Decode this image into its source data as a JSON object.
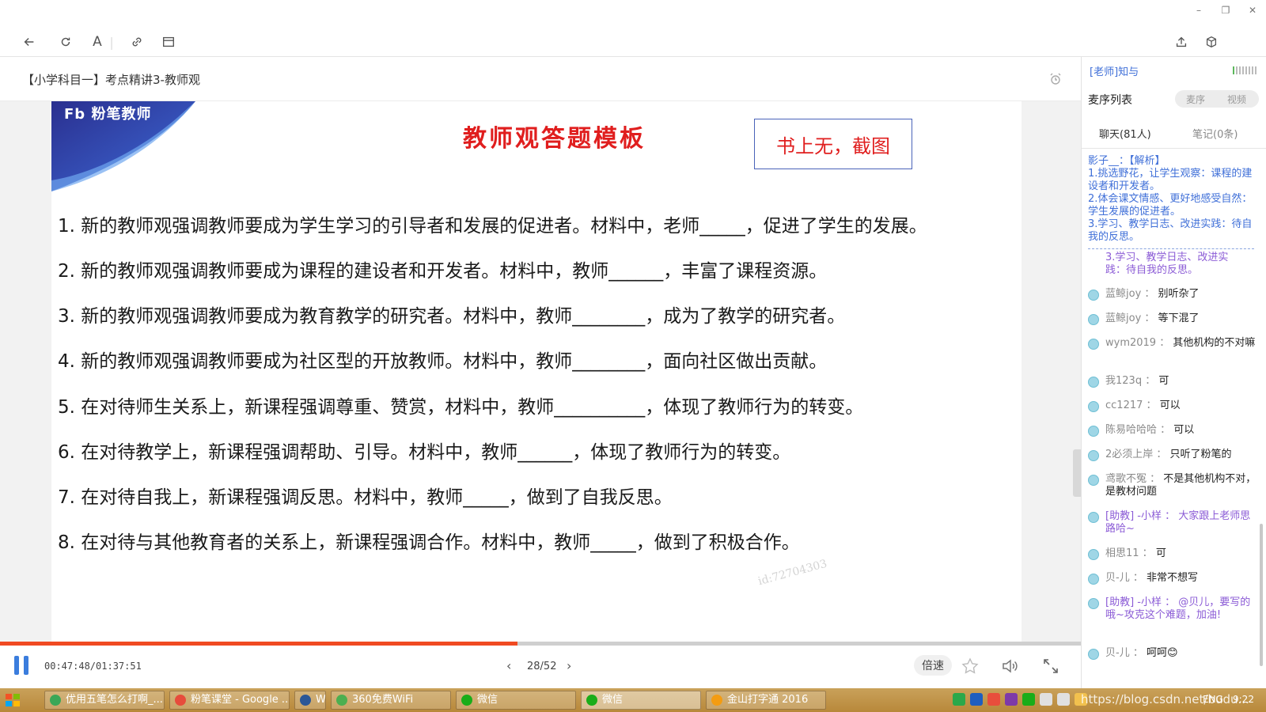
{
  "window": {
    "minimize": "–",
    "restore": "❐",
    "close": "✕"
  },
  "toolbar": {
    "back_icon": "back-arrow-icon",
    "refresh_icon": "refresh-icon",
    "font_icon": "A",
    "link_icon": "link-icon",
    "layout_icon": "window-icon",
    "share_icon": "share-icon",
    "box_icon": "cube-icon"
  },
  "course": {
    "title": "【小学科目一】考点精讲3-教师观"
  },
  "slide": {
    "logo": "Fb 粉笔教师",
    "heading": "教师观答题模板",
    "note_box": "书上无，截图",
    "watermark": "id:72704303",
    "questions": [
      "1. 新的教师观强调教师要成为学生学习的引导者和发展的促进者。材料中，老师_____，促进了学生的发展。",
      "2. 新的教师观强调教师要成为课程的建设者和开发者。材料中，教师______，丰富了课程资源。",
      "3. 新的教师观强调教师要成为教育教学的研究者。材料中，教师________，成为了教学的研究者。",
      "4. 新的教师观强调教师要成为社区型的开放教师。材料中，教师________，面向社区做出贡献。",
      "5. 在对待师生关系上，新课程强调尊重、赞赏，材料中，教师__________，体现了教师行为的转变。",
      "6. 在对待教学上，新课程强调帮助、引导。材料中，教师______，体现了教师行为的转变。",
      "7. 在对待自我上，新课程强调反思。材料中，教师_____，做到了自我反思。",
      "8. 在对待与其他教育者的关系上，新课程强调合作。材料中，教师_____，做到了积极合作。"
    ]
  },
  "player": {
    "time": "00:47:48/01:37:51",
    "progress": 0.4785,
    "page_current": 28,
    "page_total": 52,
    "page_text": "28/52",
    "speed_label": "倍速",
    "colors": {
      "progress": "#f04a22",
      "accent": "#3b7ddd"
    }
  },
  "side": {
    "teacher": "[老师]知与",
    "mic_label": "麦序列表",
    "mic_toggle": {
      "left": "麦序",
      "right": "视频"
    },
    "tabs": {
      "chat": "聊天(81人)",
      "notes": "笔记(0条)"
    },
    "pinned": "影子__：【解析】\n1.挑选野花，让学生观察：课程的建设者和开发者。\n2.体会课文情感、更好地感受自然：学生发展的促进者。\n3.学习、教学日志、改进实践：待自我的反思。",
    "pinned_tail": "3.学习、教学日志、改进实践：待自我的反思。",
    "messages": [
      {
        "user": "蓝鲸joy",
        "text": "别听杂了",
        "role": "student"
      },
      {
        "user": "蓝鲸joy",
        "text": "等下混了",
        "role": "student"
      },
      {
        "user": "wym2019",
        "text": "其他机构的不对嘛",
        "role": "student"
      },
      {
        "user": "我123q",
        "text": "可",
        "role": "student"
      },
      {
        "user": "cc1217",
        "text": "可以",
        "role": "student"
      },
      {
        "user": "陈易哈哈哈",
        "text": "可以",
        "role": "student"
      },
      {
        "user": "2必须上岸",
        "text": "只听了粉笔的",
        "role": "student"
      },
      {
        "user": "鸢歌不冤",
        "text": "不是其他机构不对，是教材问题",
        "role": "student"
      },
      {
        "user": "[助教] -小样",
        "text": "大家跟上老师思路哈~",
        "role": "assistant"
      },
      {
        "user": "相思11",
        "text": "可",
        "role": "student"
      },
      {
        "user": "贝-儿",
        "text": "非常不想写",
        "role": "student"
      },
      {
        "user": "[助教] -小样",
        "text": "@贝儿，要写的哦~攻克这个难题，加油!",
        "role": "assistant"
      },
      {
        "user": "贝-儿",
        "text": "呵呵😊",
        "role": "student"
      }
    ]
  },
  "taskbar": {
    "tasks": [
      {
        "label": "优用五笔怎么打啊_...",
        "icon_color": "#3aa757"
      },
      {
        "label": "粉笔课堂 - Google ...",
        "icon_color": "#e74c3c"
      },
      {
        "label": "W",
        "icon_color": "#2b5797"
      },
      {
        "label": "360免费WiFi",
        "icon_color": "#4caf50"
      },
      {
        "label": "微信",
        "icon_color": "#1aad19"
      },
      {
        "label": "微信",
        "icon_color": "#1aad19"
      },
      {
        "label": "金山打字通 2016",
        "icon_color": "#f39c12"
      }
    ],
    "lang": "ENG",
    "clock": "9:22",
    "watermark": "https://blog.csdn.net/budu..."
  }
}
